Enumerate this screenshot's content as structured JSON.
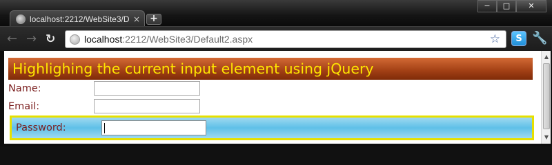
{
  "browser": {
    "tab": {
      "title": "localhost:2212/WebSite3/D",
      "close_glyph": "×"
    },
    "newtab_glyph": "+",
    "window_buttons": {
      "minimize": "−",
      "maximize": "□",
      "close": "✕"
    },
    "nav": {
      "back": "←",
      "forward": "→",
      "reload": "↻"
    },
    "address_bar": {
      "host": "localhost",
      "path": ":2212/WebSite3/Default2.aspx"
    },
    "bookmark_star": "☆",
    "extensions": {
      "skype_glyph": "S",
      "wrench_glyph": "🔧"
    }
  },
  "page": {
    "heading": "Highlighing the current input element using jQuery",
    "fields": {
      "name": {
        "label": "Name:",
        "value": ""
      },
      "email": {
        "label": "Email:",
        "value": ""
      },
      "password": {
        "label": "Password:",
        "value": ""
      }
    }
  },
  "colors": {
    "heading_text": "#ffe600",
    "label_text": "#7b1f1f",
    "focus_border": "#e6e000",
    "focus_background": "#5fc0e8"
  }
}
